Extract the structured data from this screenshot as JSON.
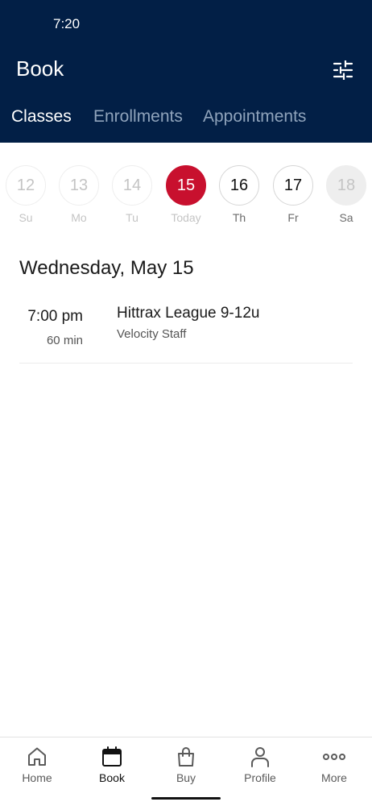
{
  "status_bar": {
    "time": "7:20"
  },
  "header": {
    "title": "Book",
    "filter_icon": "sliders-icon"
  },
  "tabs": [
    {
      "label": "Classes",
      "active": true
    },
    {
      "label": "Enrollments",
      "active": false
    },
    {
      "label": "Appointments",
      "active": false
    }
  ],
  "week": [
    {
      "number": "12",
      "label": "Su",
      "state": "past"
    },
    {
      "number": "13",
      "label": "Mo",
      "state": "past"
    },
    {
      "number": "14",
      "label": "Tu",
      "state": "past"
    },
    {
      "number": "15",
      "label": "Today",
      "state": "selected"
    },
    {
      "number": "16",
      "label": "Th",
      "state": "future"
    },
    {
      "number": "17",
      "label": "Fr",
      "state": "future"
    },
    {
      "number": "18",
      "label": "Sa",
      "state": "disabled"
    }
  ],
  "schedule": {
    "date_heading": "Wednesday, May 15",
    "classes": [
      {
        "time": "7:00 pm",
        "duration": "60 min",
        "name": "Hittrax League 9-12u",
        "staff": "Velocity Staff"
      }
    ]
  },
  "bottom_nav": [
    {
      "label": "Home",
      "icon": "home-icon",
      "active": false
    },
    {
      "label": "Book",
      "icon": "calendar-icon",
      "active": true
    },
    {
      "label": "Buy",
      "icon": "shopping-bag-icon",
      "active": false
    },
    {
      "label": "Profile",
      "icon": "person-icon",
      "active": false
    },
    {
      "label": "More",
      "icon": "more-dots-icon",
      "active": false
    }
  ],
  "colors": {
    "header_bg": "#021f46",
    "accent_today": "#c8102e",
    "tab_inactive": "#8fa3bb"
  }
}
